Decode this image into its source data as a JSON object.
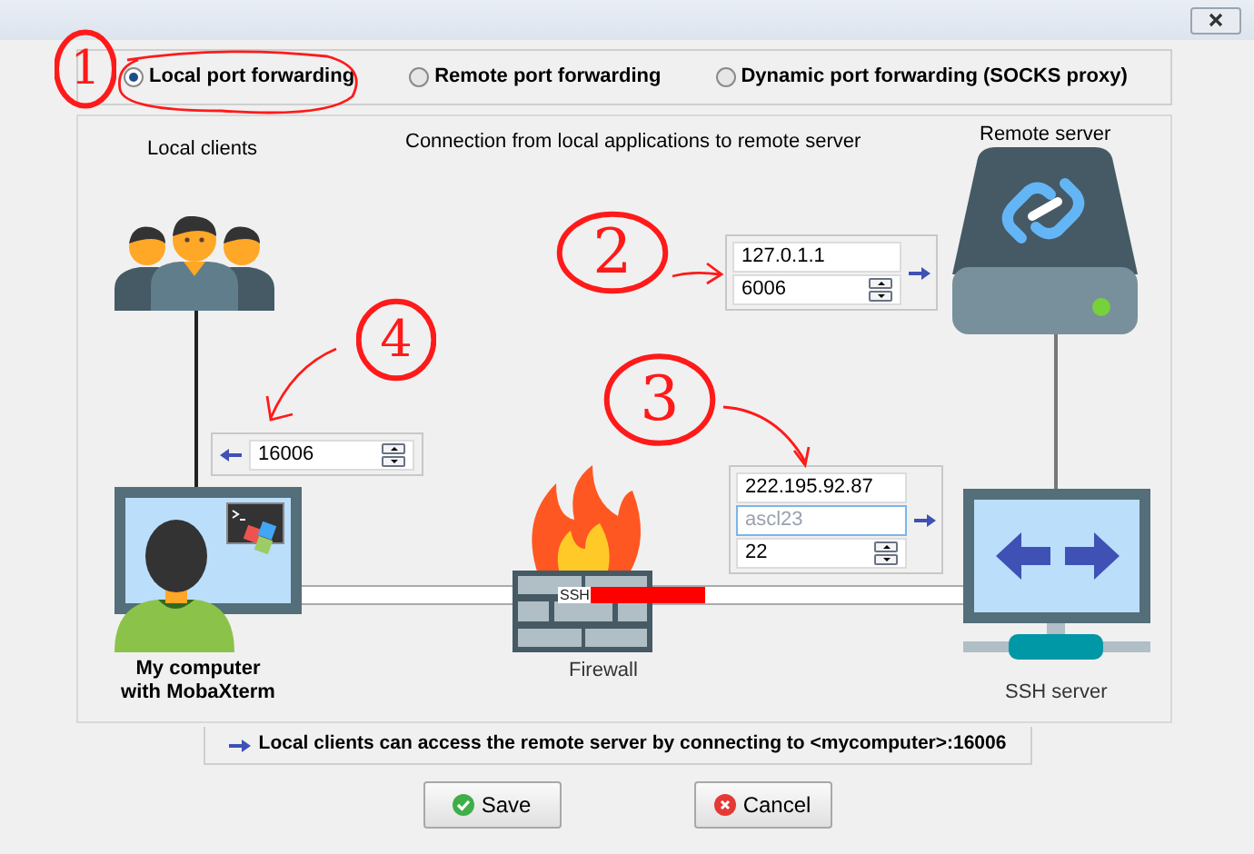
{
  "modes": [
    {
      "label": "Local port forwarding",
      "selected": true
    },
    {
      "label": "Remote port forwarding",
      "selected": false
    },
    {
      "label": "Dynamic port forwarding (SOCKS proxy)",
      "selected": false
    }
  ],
  "diagram": {
    "local_clients_label": "Local clients",
    "caption": "Connection from local applications to remote server",
    "remote_server_label": "Remote server",
    "local_port": "16006",
    "remote": {
      "host": "127.0.1.1",
      "port": "6006"
    },
    "ssh": {
      "host": "222.195.92.87",
      "user": "ascl23",
      "port": "22"
    },
    "tunnel_label": "SSH",
    "computer_label": [
      "My computer",
      "with MobaXterm"
    ],
    "firewall_label": "Firewall",
    "ssh_server_label": "SSH server"
  },
  "info": "Local clients can access the remote server by connecting to <mycomputer>:16006",
  "buttons": [
    {
      "label": "Save",
      "kind": "save"
    },
    {
      "label": "Cancel",
      "kind": "cancel"
    }
  ],
  "annotations": [
    "1",
    "2",
    "3",
    "4"
  ]
}
